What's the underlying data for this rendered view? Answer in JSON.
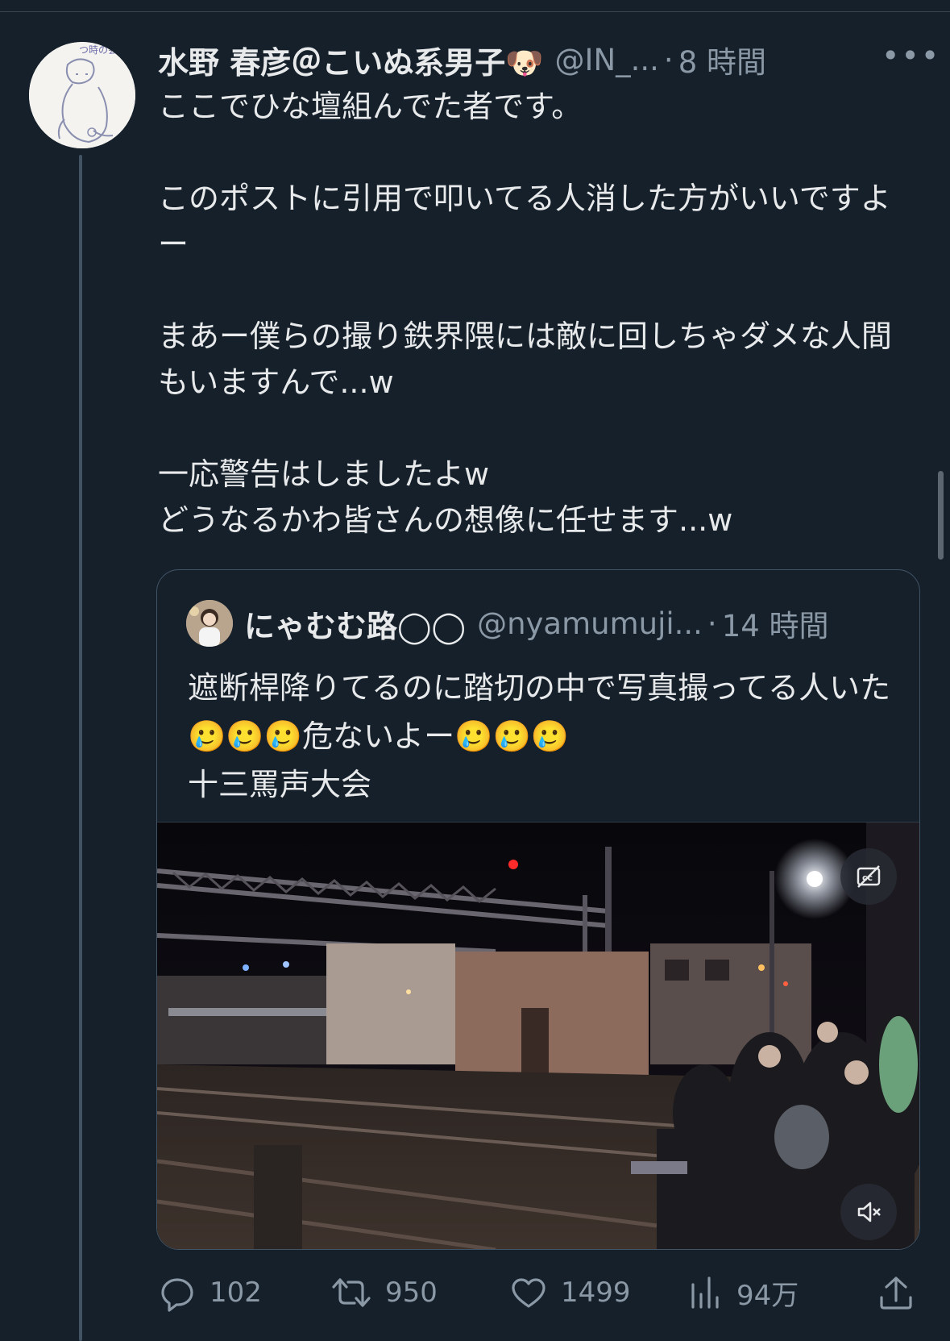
{
  "post": {
    "author_name": "水野 春彦＠こいぬ系男子🐶",
    "handle": "@IN_...",
    "separator": "·",
    "time": "8 時間",
    "more_label": "•••",
    "text": "ここでひな壇組んでた者です。\n\nこのポストに引用で叩いてる人消した方がいいですよー\n\nまあー僕らの撮り鉄界隈には敵に回しちゃダメな人間もいますんで...w\n\n一応警告はしましたよw\nどうなるかわ皆さんの想像に任せます...w"
  },
  "quoted": {
    "author_name": "にゃむむ路◯◯",
    "handle": "@nyamumuji...",
    "separator": "·",
    "time": "14 時間",
    "text": "遮断桿降りてるのに踏切の中で写真撮ってる人いた🥲🥲🥲危ないよー🥲🥲🥲\n十三罵声大会",
    "media": {
      "caption_toggle_icon": "closed-captions-off-icon",
      "mute_icon": "speaker-muted-icon"
    }
  },
  "actions": {
    "replies": "102",
    "reposts": "950",
    "likes": "1499",
    "views": "94万"
  },
  "colors": {
    "background": "#15202b",
    "text": "#e7e9ea",
    "secondary": "#8b98a5",
    "border": "#425364"
  }
}
